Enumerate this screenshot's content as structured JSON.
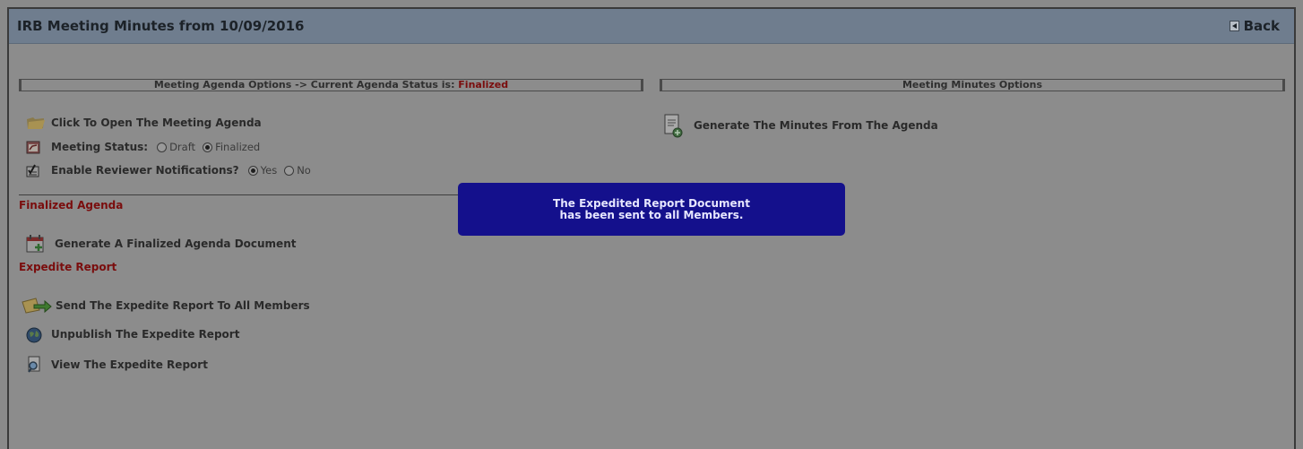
{
  "header": {
    "title": "IRB Meeting Minutes from 10/09/2016",
    "back_label": "Back"
  },
  "agenda_section": {
    "prefix": "Meeting Agenda Options -> Current Agenda Status is: ",
    "status": "Finalized"
  },
  "minutes_section": {
    "title": "Meeting Minutes Options"
  },
  "agenda_options": {
    "open_agenda": "Click To Open The Meeting Agenda",
    "meeting_status_label": "Meeting Status:",
    "meeting_status_options": [
      "Draft",
      "Finalized"
    ],
    "meeting_status_selected": "Finalized",
    "notifications_label": "Enable Reviewer Notifications?",
    "notifications_options": [
      "Yes",
      "No"
    ],
    "notifications_selected": "Yes"
  },
  "minutes_options": {
    "generate_minutes": "Generate The Minutes From The Agenda"
  },
  "finalized_agenda": {
    "title": "Finalized Agenda",
    "generate_doc": "Generate A Finalized Agenda Document"
  },
  "expedite_report": {
    "title": "Expedite Report",
    "send": "Send The Expedite Report To All Members",
    "unpublish": "Unpublish The Expedite Report",
    "view": "View The Expedite Report"
  },
  "toast": {
    "message": "The Expedited Report Document has been sent to all Members."
  },
  "colors": {
    "status_red": "#7a0d0d",
    "toast_bg": "#14108c",
    "header_bg": "#6f7d8e"
  }
}
